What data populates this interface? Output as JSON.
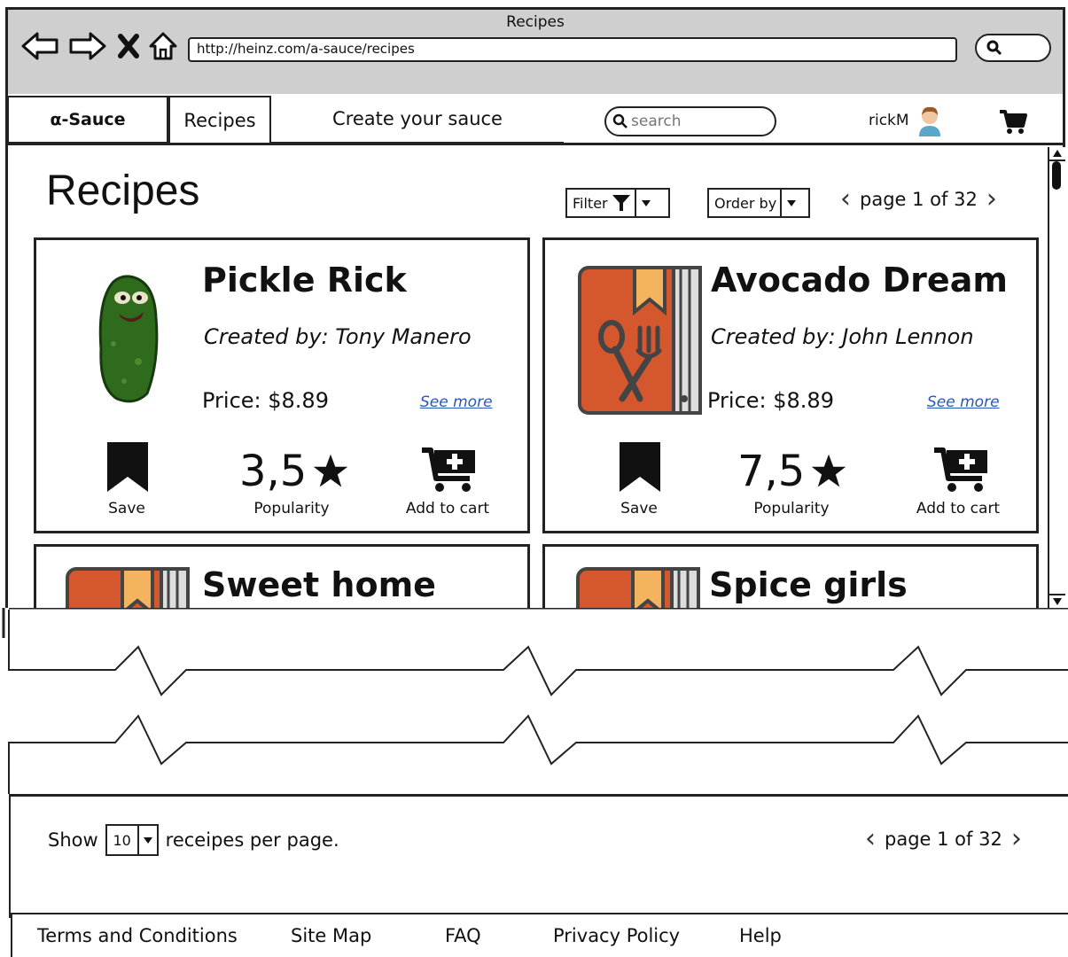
{
  "browser": {
    "title": "Recipes",
    "url": "http://heinz.com/a-sauce/recipes"
  },
  "nav": {
    "logo": "α-Sauce",
    "tab_recipes": "Recipes",
    "tab_create": "Create your sauce",
    "search_placeholder": "search",
    "username": "rickM"
  },
  "main": {
    "title": "Recipes",
    "filter_label": "Filter",
    "order_label": "Order by",
    "pager_text": "page 1 of 32"
  },
  "recipes": [
    {
      "title": "Pickle Rick",
      "author": "Created by: Tony Manero",
      "price": "Price: $8.89",
      "see_more": "See more",
      "save": "Save",
      "popularity": "3,5",
      "popularity_label": "Popularity",
      "add_to_cart": "Add to cart",
      "image": "pickle-image"
    },
    {
      "title": "Avocado Dream",
      "author": "Created by: John Lennon",
      "price": "Price: $8.89",
      "see_more": "See more",
      "save": "Save",
      "popularity": "7,5",
      "popularity_label": "Popularity",
      "add_to_cart": "Add to cart",
      "image": "recipe-book-image"
    },
    {
      "title": "Sweet home",
      "image": "recipe-book-image"
    },
    {
      "title": "Spice girls",
      "image": "recipe-book-image"
    }
  ],
  "bottom": {
    "show_label": "Show",
    "per_page_value": "10",
    "per_page_suffix": "receipes per page.",
    "pager_text": "page 1 of 32"
  },
  "footer": {
    "links": [
      "Terms and Conditions",
      "Site Map",
      "FAQ",
      "Privacy Policy",
      "Help"
    ]
  },
  "colors": {
    "book_orange": "#d4572e",
    "book_ribbon": "#f4b35e",
    "link_blue": "#2a56b8",
    "pickle_green": "#2f6b1d"
  }
}
